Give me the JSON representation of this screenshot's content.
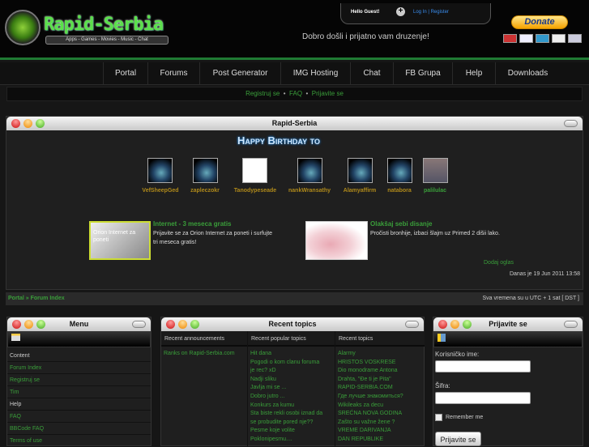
{
  "header": {
    "logo_title": "Rapid-Serbia",
    "logo_tagline": "Apps - Games - Movies - Music - Chat",
    "greeting": "Hello Guest!",
    "login_link": "Log In | Register",
    "welcome": "Dobro došli i prijatno vam druzenje!",
    "donate_label": "Donate"
  },
  "nav": {
    "items": [
      "Portal",
      "Forums",
      "Post Generator",
      "IMG Hosting",
      "Chat",
      "FB Grupa",
      "Help",
      "Downloads"
    ]
  },
  "subbar": {
    "register": "Registruj se",
    "sep": "•",
    "faq": "FAQ",
    "login": "Prijavite se"
  },
  "main_window": {
    "title": "Rapid-Serbia",
    "birthday_heading": "Happy Birthday to",
    "birthdays": [
      "VefSheepGed",
      "zapleczokr",
      "Tanodypeseade",
      "nankWransathy",
      "Alamyaffirm",
      "natabora",
      "palilulac"
    ]
  },
  "ads": [
    {
      "title": "Internet - 3 meseca gratis",
      "text": "Prijavite se za Orion Internet za poneti i surfujte tri meseca gratis!",
      "image_caption": "Orion Internet za poneti"
    },
    {
      "title": "Olakšaj sebi disanje",
      "text": "Pročisti bronhije, izbaci šlajm uz Primed 2 dišii lako."
    }
  ],
  "add_ad": "Dodaj oglas",
  "today": "Danas je 19 Jun 2011 13:58",
  "breadcrumb": "Portal » Forum Index",
  "timezone": "Sva vremena su u UTC + 1 sat [ DST ]",
  "menu": {
    "title": "Menu",
    "items": [
      {
        "label": "Content",
        "header": true
      },
      {
        "label": "Forum Index"
      },
      {
        "label": "Registruj se"
      },
      {
        "label": "Tim"
      },
      {
        "label": "Help",
        "header": true
      },
      {
        "label": "FAQ"
      },
      {
        "label": "BBCode FAQ"
      },
      {
        "label": "Terms of use"
      }
    ]
  },
  "recent": {
    "title": "Recent topics",
    "columns": [
      {
        "header": "Recent announcements",
        "items": [
          "Ranks on Rapid-Serbia.com"
        ]
      },
      {
        "header": "Recent popular topics",
        "items": [
          "Hit dana",
          "Pogodi o kom clanu foruma",
          "je rec? xD",
          "Nadji sliku",
          "Javlja mi se ...",
          "Dobro jutro ...",
          "Konkurs za kumu",
          "Sta biste rekli osobi iznad da",
          "se probudite pored nje??",
          "Pesme koje volite",
          "Poklonipesmu...."
        ]
      },
      {
        "header": "Recent topics",
        "items": [
          "Alarmy",
          "HRISTOS VOSKRESE",
          "Dio monodrame Antona",
          "Drahta, \"Đe ti je Pita\"",
          "RAPID-SERBIA.COM",
          "Где лучше знакомиться?",
          "Wikileaks za decu",
          "SREĆNA NOVA GODINA",
          "Zašto su važne žene ?",
          "VREME DARIVANJA",
          "DAN REPUBLIKE"
        ]
      }
    ]
  },
  "login": {
    "title": "Prijavite se",
    "username_label": "Korisničko ime:",
    "password_label": "Šifra:",
    "remember": "Remember me",
    "submit": "Prijavite se"
  }
}
